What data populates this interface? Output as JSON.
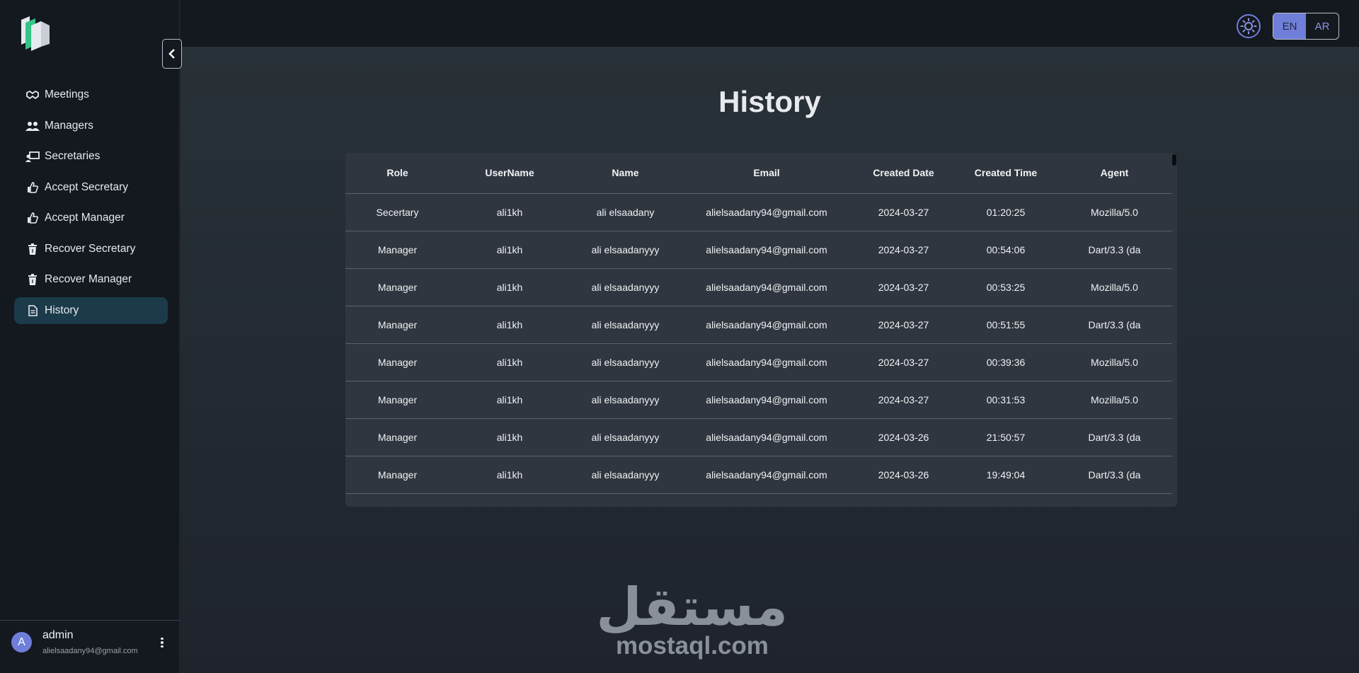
{
  "sidebar": {
    "items": [
      {
        "label": "Meetings",
        "icon": "handshake-icon"
      },
      {
        "label": "Managers",
        "icon": "users-icon"
      },
      {
        "label": "Secretaries",
        "icon": "chalkboard-user-icon"
      },
      {
        "label": "Accept Secretary",
        "icon": "thumbs-up-icon"
      },
      {
        "label": "Accept Manager",
        "icon": "thumbs-up-icon"
      },
      {
        "label": "Recover Secretary",
        "icon": "trash-icon"
      },
      {
        "label": "Recover Manager",
        "icon": "trash-icon"
      },
      {
        "label": "History",
        "icon": "file-icon",
        "active": true
      }
    ],
    "user": {
      "avatar_letter": "A",
      "name": "admin",
      "email": "alielsaadany94@gmail.com"
    }
  },
  "topbar": {
    "lang_options": [
      "EN",
      "AR"
    ],
    "active_lang": "EN"
  },
  "main": {
    "title": "History",
    "table": {
      "columns": [
        "Role",
        "UserName",
        "Name",
        "Email",
        "Created Date",
        "Created Time",
        "Agent"
      ],
      "rows": [
        [
          "Secertary",
          "ali1kh",
          "ali elsaadany",
          "alielsaadany94@gmail.com",
          "2024-03-27",
          "01:20:25",
          "Mozilla/5.0"
        ],
        [
          "Manager",
          "ali1kh",
          "ali elsaadanyyy",
          "alielsaadany94@gmail.com",
          "2024-03-27",
          "00:54:06",
          "Dart/3.3 (da"
        ],
        [
          "Manager",
          "ali1kh",
          "ali elsaadanyyy",
          "alielsaadany94@gmail.com",
          "2024-03-27",
          "00:53:25",
          "Mozilla/5.0"
        ],
        [
          "Manager",
          "ali1kh",
          "ali elsaadanyyy",
          "alielsaadany94@gmail.com",
          "2024-03-27",
          "00:51:55",
          "Dart/3.3 (da"
        ],
        [
          "Manager",
          "ali1kh",
          "ali elsaadanyyy",
          "alielsaadany94@gmail.com",
          "2024-03-27",
          "00:39:36",
          "Mozilla/5.0"
        ],
        [
          "Manager",
          "ali1kh",
          "ali elsaadanyyy",
          "alielsaadany94@gmail.com",
          "2024-03-27",
          "00:31:53",
          "Mozilla/5.0"
        ],
        [
          "Manager",
          "ali1kh",
          "ali elsaadanyyy",
          "alielsaadany94@gmail.com",
          "2024-03-26",
          "21:50:57",
          "Dart/3.3 (da"
        ],
        [
          "Manager",
          "ali1kh",
          "ali elsaadanyyy",
          "alielsaadany94@gmail.com",
          "2024-03-26",
          "19:49:04",
          "Dart/3.3 (da"
        ]
      ]
    }
  },
  "watermark": {
    "arabic": "مستقل",
    "latin": "mostaql.com"
  },
  "colors": {
    "accent": "#6f7ed9",
    "active_nav": "#1b3b4a",
    "logo_green": "#33c486"
  }
}
